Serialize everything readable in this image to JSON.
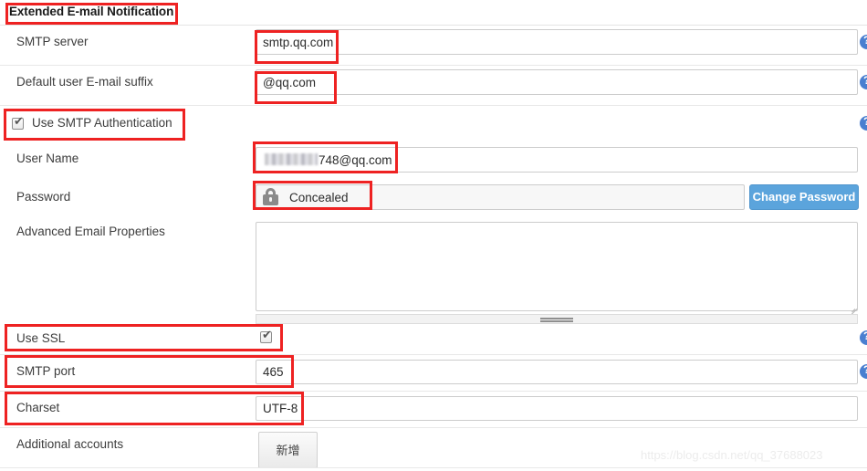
{
  "section": {
    "title": "Extended E-mail Notification"
  },
  "fields": {
    "smtp_server": {
      "label": "SMTP server",
      "value": "smtp.qq.com",
      "placeholder": ""
    },
    "email_suffix": {
      "label": "Default user E-mail suffix",
      "value": "@qq.com",
      "placeholder": ""
    },
    "use_smtp_auth": {
      "label": "Use SMTP Authentication",
      "checked": true,
      "check_glyph": "✔"
    },
    "user_name": {
      "label": "User Name",
      "value": "748@qq.com",
      "redacted_prefix": true,
      "placeholder": ""
    },
    "password": {
      "label": "Password",
      "value": "Concealed",
      "icon": "lock-icon",
      "change_button": "Change Password"
    },
    "advanced_props": {
      "label": "Advanced Email Properties",
      "value": "",
      "placeholder": ""
    },
    "use_ssl": {
      "label": "Use SSL",
      "checked": true,
      "check_glyph": "✔"
    },
    "smtp_port": {
      "label": "SMTP port",
      "value": "465",
      "placeholder": ""
    },
    "charset": {
      "label": "Charset",
      "value": "UTF-8",
      "placeholder": ""
    },
    "additional_accounts": {
      "label": "Additional accounts",
      "add_button": "新增"
    }
  },
  "help": {
    "glyph": "?",
    "count": 5
  },
  "watermark": {
    "text": "https://blog.csdn.net/qq_37688023"
  },
  "colors": {
    "accent_button": "#5ba4dc",
    "annotation": "#ee2222",
    "help_icon": "#4a7fd0",
    "border": "#cccccc",
    "watermark": "#ececec"
  }
}
